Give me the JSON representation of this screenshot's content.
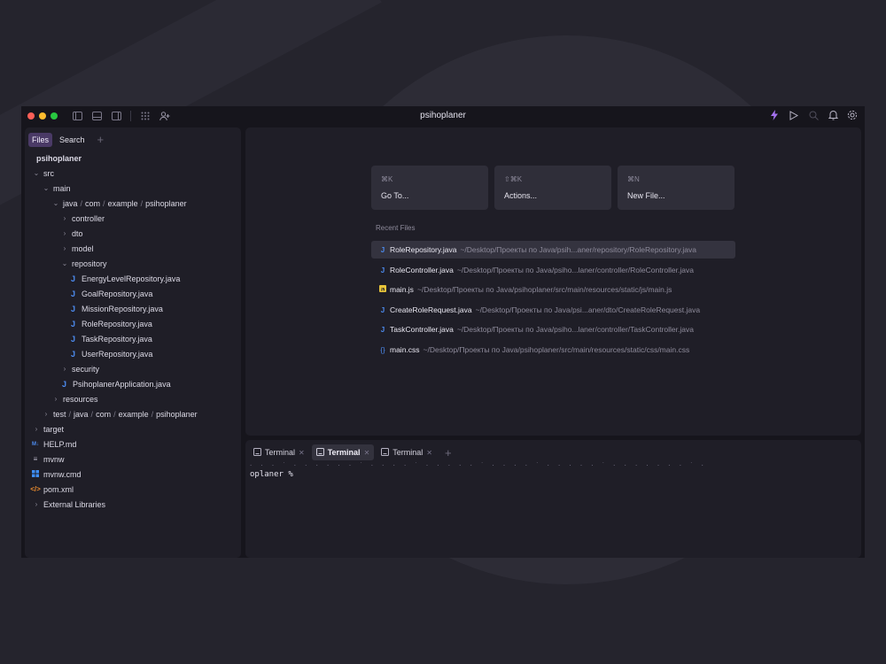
{
  "window": {
    "title": "psihoplaner"
  },
  "sidebar": {
    "tabs": [
      "Files",
      "Search"
    ],
    "add_label": "+",
    "root": "psihoplaner",
    "items": [
      {
        "label": "src",
        "type": "folder",
        "expanded": true
      },
      {
        "label": "main",
        "type": "folder",
        "expanded": true
      },
      {
        "label": "java / com / example / psihoplaner",
        "type": "path",
        "expanded": true
      },
      {
        "label": "controller",
        "type": "folder",
        "expanded": false
      },
      {
        "label": "dto",
        "type": "folder",
        "expanded": false
      },
      {
        "label": "model",
        "type": "folder",
        "expanded": false
      },
      {
        "label": "repository",
        "type": "folder",
        "expanded": true
      },
      {
        "label": "EnergyLevelRepository.java",
        "type": "java"
      },
      {
        "label": "GoalRepository.java",
        "type": "java"
      },
      {
        "label": "MissionRepository.java",
        "type": "java"
      },
      {
        "label": "RoleRepository.java",
        "type": "java"
      },
      {
        "label": "TaskRepository.java",
        "type": "java"
      },
      {
        "label": "UserRepository.java",
        "type": "java"
      },
      {
        "label": "security",
        "type": "folder",
        "expanded": false
      },
      {
        "label": "PsihoplanerApplication.java",
        "type": "java"
      },
      {
        "label": "resources",
        "type": "folder",
        "expanded": false
      },
      {
        "label": "test / java / com / example / psihoplaner",
        "type": "path",
        "expanded": false
      },
      {
        "label": "target",
        "type": "folder",
        "expanded": false
      },
      {
        "label": "HELP.md",
        "type": "md"
      },
      {
        "label": "mvnw",
        "type": "script"
      },
      {
        "label": "mvnw.cmd",
        "type": "cmd"
      },
      {
        "label": "pom.xml",
        "type": "xml"
      },
      {
        "label": "External Libraries",
        "type": "folder",
        "expanded": false
      }
    ]
  },
  "quick_actions": [
    {
      "shortcut": "⌘K",
      "label": "Go To..."
    },
    {
      "shortcut": "⇧⌘K",
      "label": "Actions..."
    },
    {
      "shortcut": "⌘N",
      "label": "New File..."
    }
  ],
  "recent": {
    "title": "Recent Files",
    "files": [
      {
        "name": "RoleRepository.java",
        "path": "~/Desktop/Проекты по Java/psih...aner/repository/RoleRepository.java",
        "icon": "java"
      },
      {
        "name": "RoleController.java",
        "path": "~/Desktop/Проекты по Java/psiho...laner/controller/RoleController.java",
        "icon": "java"
      },
      {
        "name": "main.js",
        "path": "~/Desktop/Проекты по Java/psihoplaner/src/main/resources/static/js/main.js",
        "icon": "js"
      },
      {
        "name": "CreateRoleRequest.java",
        "path": "~/Desktop/Проекты по Java/psi...aner/dto/CreateRoleRequest.java",
        "icon": "java"
      },
      {
        "name": "TaskController.java",
        "path": "~/Desktop/Проекты по Java/psiho...laner/controller/TaskController.java",
        "icon": "java"
      },
      {
        "name": "main.css",
        "path": "~/Desktop/Проекты по Java/psihoplaner/src/main/resources/static/css/main.css",
        "icon": "css"
      }
    ]
  },
  "terminal": {
    "tabs": [
      "Terminal",
      "Terminal",
      "Terminal"
    ],
    "active_index": 1,
    "prompt": "oplaner %"
  },
  "colors": {
    "accent": "#4a3a66",
    "java_icon": "#4d8cf0",
    "lightning": "#a472f0"
  }
}
